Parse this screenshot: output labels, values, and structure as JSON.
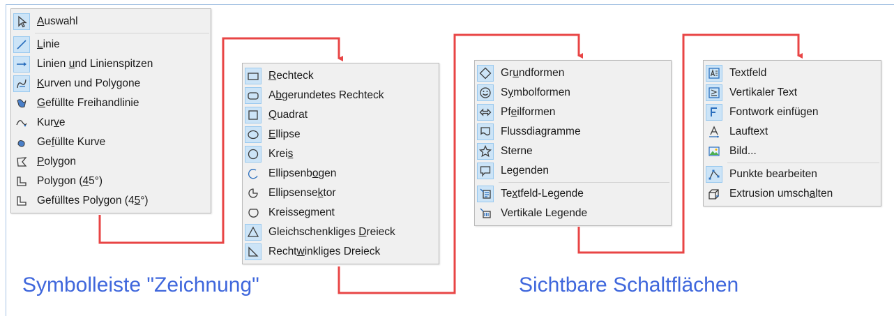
{
  "menus": {
    "draw": {
      "items": [
        {
          "pre": "",
          "mn": "A",
          "post": "uswahl",
          "icon": "cursor-icon",
          "on": true
        },
        {
          "pre": "",
          "mn": "L",
          "post": "inie",
          "icon": "line-icon",
          "on": true
        },
        {
          "pre": "Linien ",
          "mn": "u",
          "post": "nd Linienspitzen",
          "icon": "line-arrow-icon",
          "on": true
        },
        {
          "pre": "",
          "mn": "K",
          "post": "urven und Polygone",
          "icon": "curves-polygons-icon",
          "on": true
        },
        {
          "pre": "",
          "mn": "G",
          "post": "efüllte Freihandlinie",
          "icon": "filled-freeform-icon",
          "on": false
        },
        {
          "pre": "Kur",
          "mn": "v",
          "post": "e",
          "icon": "curve-icon",
          "on": false
        },
        {
          "pre": "Ge",
          "mn": "f",
          "post": "üllte Kurve",
          "icon": "filled-curve-icon",
          "on": false
        },
        {
          "pre": "",
          "mn": "P",
          "post": "olygon",
          "icon": "polygon-icon",
          "on": false
        },
        {
          "pre": "Polygon (",
          "mn": "4",
          "post": "5°)",
          "icon": "polygon-45-icon",
          "on": false
        },
        {
          "pre": "Gefülltes Polygon (4",
          "mn": "5",
          "post": "°)",
          "icon": "filled-polygon-45-icon",
          "on": false
        }
      ]
    },
    "basic": {
      "items": [
        {
          "pre": "",
          "mn": "R",
          "post": "echteck",
          "icon": "rectangle-icon",
          "on": true
        },
        {
          "pre": "A",
          "mn": "b",
          "post": "gerundetes Rechteck",
          "icon": "rounded-rectangle-icon",
          "on": true
        },
        {
          "pre": "",
          "mn": "Q",
          "post": "uadrat",
          "icon": "square-icon",
          "on": true
        },
        {
          "pre": "",
          "mn": "E",
          "post": "llipse",
          "icon": "ellipse-icon",
          "on": true
        },
        {
          "pre": "Krei",
          "mn": "s",
          "post": "",
          "icon": "circle-icon",
          "on": true
        },
        {
          "pre": "Ellipsenb",
          "mn": "o",
          "post": "gen",
          "icon": "ellipse-arc-icon",
          "on": false
        },
        {
          "pre": "Ellipsense",
          "mn": "k",
          "post": "tor",
          "icon": "ellipse-sector-icon",
          "on": false
        },
        {
          "pre": "Kreissegment",
          "mn": "",
          "post": "",
          "icon": "circle-segment-icon",
          "on": false
        },
        {
          "pre": "Gleichschenkliges ",
          "mn": "D",
          "post": "reieck",
          "icon": "isosceles-triangle-icon",
          "on": true
        },
        {
          "pre": "Recht",
          "mn": "w",
          "post": "inkliges Dreieck",
          "icon": "right-triangle-icon",
          "on": true
        }
      ]
    },
    "shapes": {
      "items": [
        {
          "pre": "Gr",
          "mn": "u",
          "post": "ndformen",
          "icon": "diamond-icon",
          "on": true
        },
        {
          "pre": "S",
          "mn": "y",
          "post": "mbolformen",
          "icon": "smiley-icon",
          "on": true
        },
        {
          "pre": "Pf",
          "mn": "e",
          "post": "ilformen",
          "icon": "double-arrow-icon",
          "on": true
        },
        {
          "pre": "Flussdiagramme",
          "mn": "",
          "post": "",
          "icon": "flowchart-icon",
          "on": true
        },
        {
          "pre": "Sterne",
          "mn": "",
          "post": "",
          "icon": "star-icon",
          "on": true
        },
        {
          "pre": "Legenden",
          "mn": "",
          "post": "",
          "icon": "callout-icon",
          "on": true
        },
        {
          "pre": "Te",
          "mn": "x",
          "post": "tfeld-Legende",
          "icon": "textbox-callout-icon",
          "on": true
        },
        {
          "pre": "Vertikale Legende",
          "mn": "",
          "post": "",
          "icon": "vertical-callout-icon",
          "on": false
        }
      ]
    },
    "text": {
      "items": [
        {
          "pre": "Textfeld",
          "mn": "",
          "post": "",
          "icon": "textbox-icon",
          "on": true
        },
        {
          "pre": "Vertikaler Text",
          "mn": "",
          "post": "",
          "icon": "vertical-text-icon",
          "on": true
        },
        {
          "pre": "Fontwork einfügen",
          "mn": "",
          "post": "",
          "icon": "fontwork-icon",
          "on": true
        },
        {
          "pre": "Lauftext",
          "mn": "",
          "post": "",
          "icon": "scrolling-text-icon",
          "on": false
        },
        {
          "pre": "Bild...",
          "mn": "",
          "post": "",
          "icon": "image-icon",
          "on": false
        },
        {
          "pre": "Punkte bearbeiten",
          "mn": "",
          "post": "",
          "icon": "edit-points-icon",
          "on": true
        },
        {
          "pre": "Extrusion umsch",
          "mn": "a",
          "post": "lten",
          "icon": "extrusion-icon",
          "on": false
        }
      ]
    }
  },
  "captions": {
    "left": "Symbolleiste \"Zeichnung\"",
    "right": "Sichtbare Schaltflächen"
  },
  "colors": {
    "arrow": "#e84545",
    "caption": "#3f67dc",
    "highlight": "#cce4f7"
  }
}
